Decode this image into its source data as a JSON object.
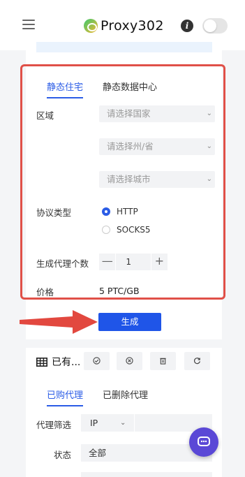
{
  "header": {
    "brand": "Proxy302",
    "info_icon": "i"
  },
  "order_panel": {
    "tabs": [
      {
        "label": "静态住宅",
        "active": true
      },
      {
        "label": "静态数据中心",
        "active": false
      }
    ],
    "region": {
      "label": "区域",
      "country_placeholder": "请选择国家",
      "state_placeholder": "请选择州/省",
      "city_placeholder": "请选择城市"
    },
    "protocol": {
      "label": "协议类型",
      "options": [
        {
          "label": "HTTP",
          "checked": true
        },
        {
          "label": "SOCKS5",
          "checked": false
        }
      ]
    },
    "quantity": {
      "label": "生成代理个数",
      "minus": "—",
      "value": "1",
      "plus": "+"
    },
    "price": {
      "label": "价格",
      "value": "5 PTC/GB"
    },
    "generate_button": "生成"
  },
  "proxies_panel": {
    "title": "已有...",
    "tabs": [
      {
        "label": "已购代理",
        "active": true
      },
      {
        "label": "已删除代理",
        "active": false
      }
    ],
    "filter": {
      "label": "代理筛选",
      "selected": "IP"
    },
    "status": {
      "label": "状态",
      "selected": "全部"
    }
  },
  "colors": {
    "accent": "#2b5ce6",
    "primary_button": "#1f55e8",
    "highlight_border": "#e05048",
    "chat_fab": "#5a48d6"
  },
  "icons": {
    "menu": "hamburger-menu-icon",
    "info": "info-icon",
    "table": "table-grid-icon",
    "check": "check-circle-icon",
    "close": "close-circle-icon",
    "delete": "trash-icon",
    "refresh": "refresh-icon",
    "chat": "chat-bubble-icon",
    "dropdown": "chevron-down-icon"
  }
}
